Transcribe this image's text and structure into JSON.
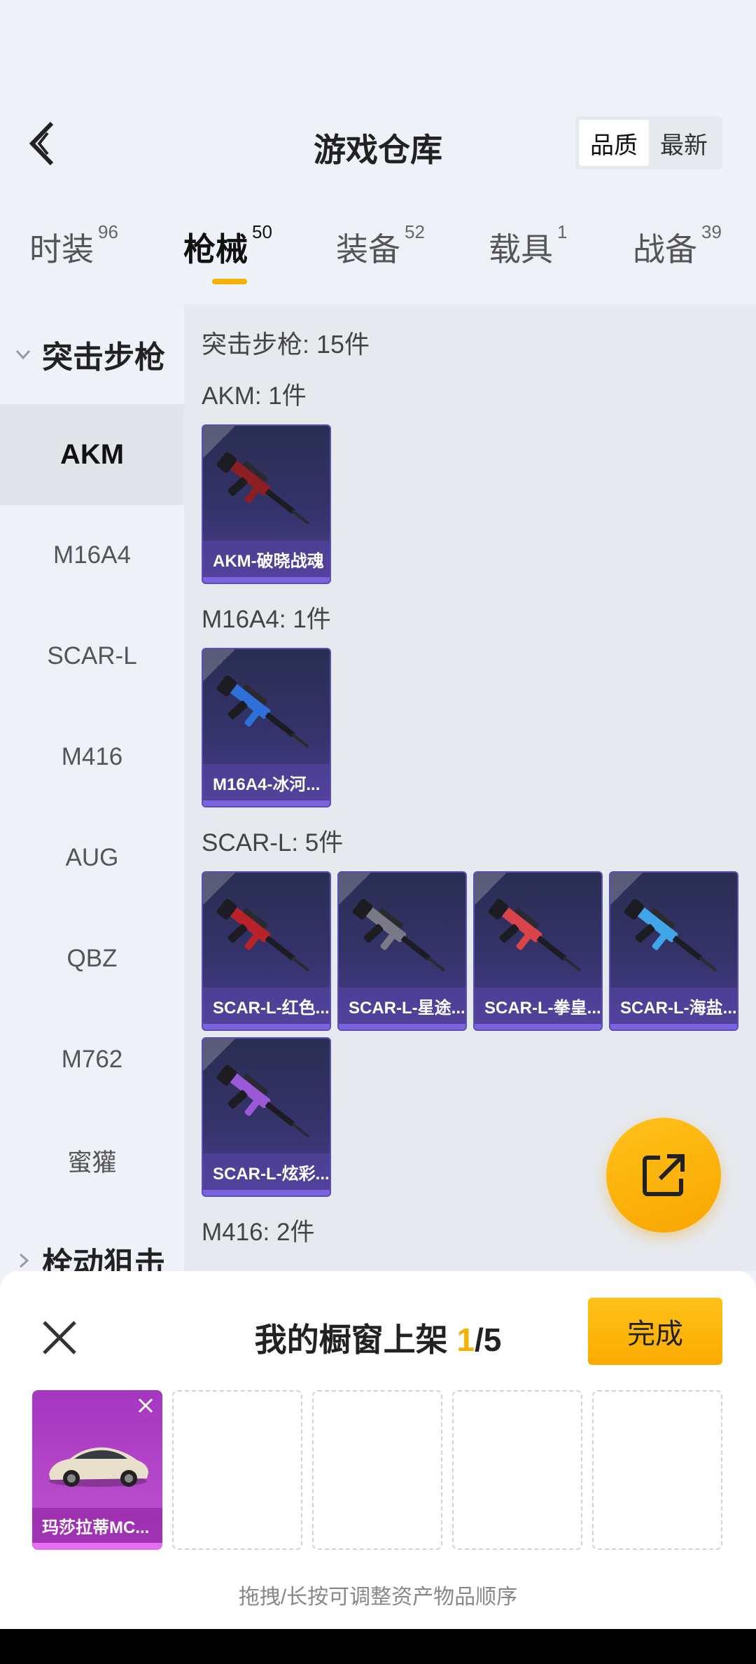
{
  "header": {
    "title": "游戏仓库",
    "sort_options": [
      "品质",
      "最新"
    ],
    "active_sort": 0
  },
  "tabs": [
    {
      "label": "时装",
      "count": "96"
    },
    {
      "label": "枪械",
      "count": "50"
    },
    {
      "label": "装备",
      "count": "52"
    },
    {
      "label": "载具",
      "count": "1"
    },
    {
      "label": "战备",
      "count": "39"
    }
  ],
  "active_tab": 1,
  "sidebar": {
    "group_expanded": "突击步枪",
    "items": [
      "AKM",
      "M16A4",
      "SCAR-L",
      "M416",
      "AUG",
      "QBZ",
      "M762",
      "蜜獾"
    ],
    "active_item": 0,
    "group_collapsed": "栓动狙击"
  },
  "content": {
    "category_title": "突击步枪: 15件",
    "sections": [
      {
        "title": "AKM: 1件",
        "items": [
          {
            "name": "AKM-破晓战魂",
            "color": "#8b1f24"
          }
        ]
      },
      {
        "title": "M16A4: 1件",
        "items": [
          {
            "name": "M16A4-冰河...",
            "color": "#2f6fd8"
          }
        ]
      },
      {
        "title": "SCAR-L: 5件",
        "items": [
          {
            "name": "SCAR-L-红色...",
            "color": "#b8232a"
          },
          {
            "name": "SCAR-L-星途...",
            "color": "#7a7a86"
          },
          {
            "name": "SCAR-L-拳皇...",
            "color": "#d9434a"
          },
          {
            "name": "SCAR-L-海盐...",
            "color": "#3fa6e8"
          },
          {
            "name": "SCAR-L-炫彩...",
            "color": "#9a5ad8"
          }
        ]
      },
      {
        "title": "M416: 2件",
        "items": []
      }
    ]
  },
  "fab": {
    "icon": "share-out-icon"
  },
  "showcase": {
    "title_prefix": "我的橱窗上架 ",
    "count": "1",
    "total": "/5",
    "done_label": "完成",
    "slots": [
      {
        "name": "玛莎拉蒂MC..."
      },
      null,
      null,
      null,
      null
    ],
    "hint": "拖拽/长按可调整资产物品顺序"
  }
}
